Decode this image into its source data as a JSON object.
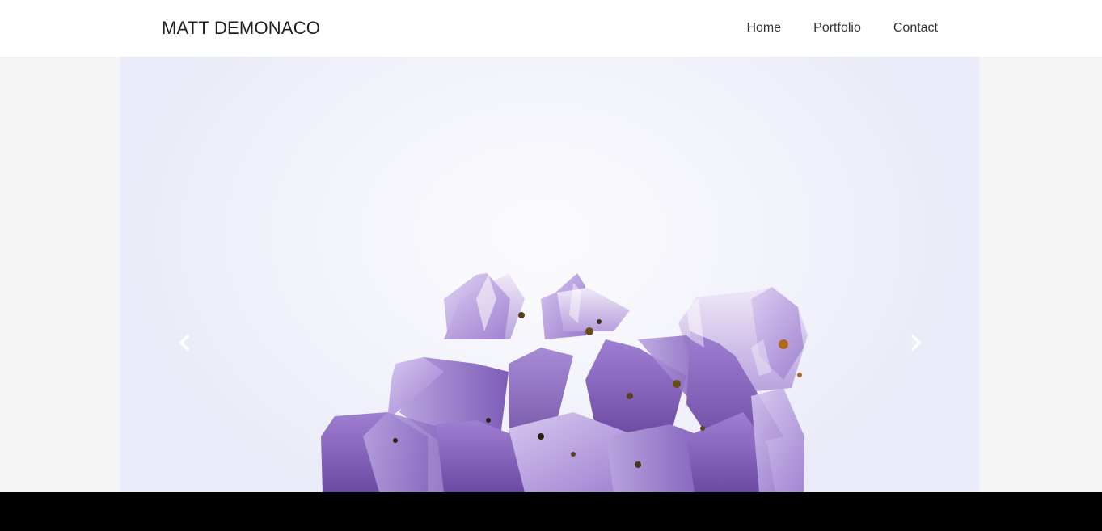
{
  "navbar": {
    "brand": "MATT DEMONACO",
    "links": [
      {
        "label": "Home"
      },
      {
        "label": "Portfolio"
      },
      {
        "label": "Contact"
      }
    ]
  },
  "carousel": {
    "slide_image": "amethyst-crystal-cluster-photo",
    "prev_icon": "chevron-left-icon",
    "next_icon": "chevron-right-icon"
  },
  "colors": {
    "page_background": "#f5f5f5",
    "navbar_background": "#ffffff",
    "footer_background": "#000000",
    "crystal_purple": "#8a67c2"
  }
}
